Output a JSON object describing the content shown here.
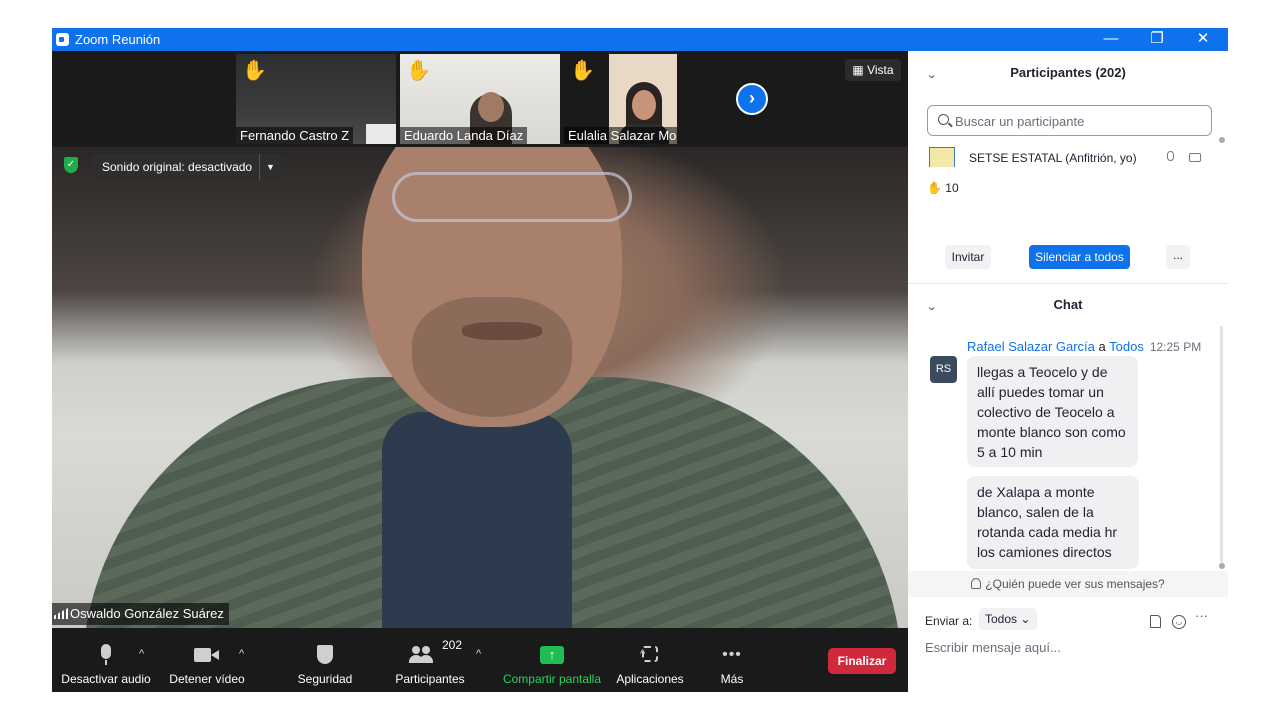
{
  "window": {
    "title": "Zoom Reunión",
    "controls": [
      "—",
      "❐",
      "✕"
    ]
  },
  "video": {
    "thumbnails": [
      {
        "name": "Fernando Castro Z",
        "hand": "✋"
      },
      {
        "name": "Eduardo Landa Díaz",
        "hand": "✋"
      },
      {
        "name": "Eulalia Salazar Montes",
        "hand": "✋"
      }
    ],
    "next_icon": "›",
    "view_label": "Vista",
    "original_sound": "Sonido original: desactivado",
    "speaker_name": "Oswaldo González Suárez"
  },
  "toolbar": {
    "audio": "Desactivar audio",
    "video": "Detener vídeo",
    "security": "Seguridad",
    "participants": "Participantes",
    "participants_count": "202",
    "share": "Compartir pantalla",
    "apps": "Aplicaciones",
    "more": "Más",
    "end": "Finalizar",
    "caret": "^"
  },
  "panel": {
    "participants_title": "Participantes (202)",
    "search_placeholder": "Buscar un participante",
    "host_row": "SETSE ESTATAL (Anfitrión, yo)",
    "hands_raised": "✋ 10",
    "invite": "Invitar",
    "mute_all": "Silenciar a todos",
    "more": "...",
    "chat_title": "Chat",
    "message": {
      "from": "Rafael Salazar García",
      "sep": " a ",
      "to": "Todos",
      "time": "12:25 PM",
      "avatar": "RS",
      "bubbles": [
        "llegas a Teocelo y de allí puedes tomar un colectivo de Teocelo a monte blanco son como 5 a 10 min",
        "de Xalapa a monte blanco, salen de la rotanda cada media hr los camiones directos"
      ]
    },
    "who_can_see": "¿Quién puede ver sus mensajes?",
    "send_to_label": "Enviar a:",
    "send_to_value": "Todos ⌄",
    "input_placeholder": "Escribir mensaje aquí..."
  }
}
